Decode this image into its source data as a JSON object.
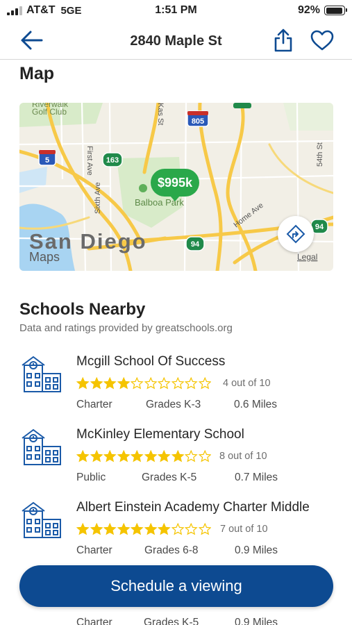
{
  "status_bar": {
    "carrier": "AT&T",
    "network": "5GE",
    "time": "1:51 PM",
    "battery": "92%",
    "battery_level": 0.92
  },
  "nav": {
    "title": "2840 Maple St"
  },
  "map_section": {
    "heading": "Map",
    "price_pin": "$995k",
    "city_label": "San Diego",
    "maps_brand": "Maps",
    "legal": "Legal",
    "places": [
      "Riverwalk",
      "Golf Club",
      "Balboa Park"
    ],
    "streets": [
      "Kas St",
      "First Ave",
      "Sixth Ave",
      "Home Ave",
      "54th St"
    ],
    "shields": [
      "805",
      "5",
      "163",
      "94",
      "15",
      "94"
    ]
  },
  "schools": {
    "heading": "Schools Nearby",
    "source": "Data and ratings provided by greatschools.org",
    "items": [
      {
        "name": "Mcgill School Of Success",
        "rating": 4,
        "max": 10,
        "rating_text": "4 out of 10",
        "type": "Charter",
        "grades": "Grades K-3",
        "distance": "0.6 Miles"
      },
      {
        "name": "McKinley Elementary School",
        "rating": 8,
        "max": 10,
        "rating_text": "8 out of 10",
        "type": "Public",
        "grades": "Grades K-5",
        "distance": "0.7 Miles"
      },
      {
        "name": "Albert Einstein Academy Charter Middle",
        "rating": 7,
        "max": 10,
        "rating_text": "7 out of 10",
        "type": "Charter",
        "grades": "Grades 6-8",
        "distance": "0.9 Miles"
      }
    ],
    "partial_next": {
      "type": "Charter",
      "grades": "Grades K-5",
      "distance": "0.9 Miles"
    }
  },
  "cta": {
    "label": "Schedule a viewing"
  },
  "colors": {
    "accent": "#0d4a91",
    "star": "#f5c400",
    "pin": "#2aa84a",
    "icon_blue": "#1a5aa8"
  }
}
